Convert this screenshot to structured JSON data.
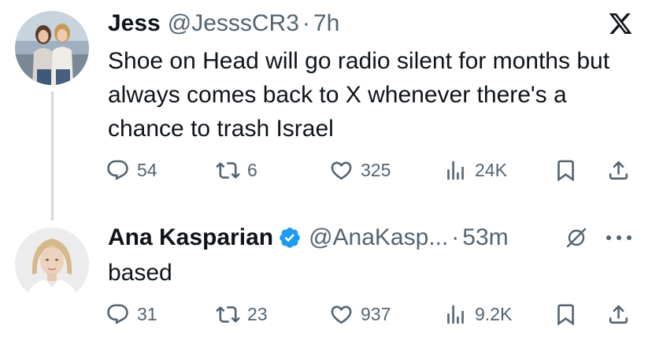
{
  "tweets": [
    {
      "author": {
        "name": "Jess",
        "handle": "@JesssCR3",
        "verified": false
      },
      "separator": "·",
      "time": "7h",
      "text": "Shoe on Head will go radio silent for months but always comes back to X whenever there's a chance to trash Israel",
      "stats": {
        "replies": "54",
        "reposts": "6",
        "likes": "325",
        "views": "24K"
      },
      "corner_icon": "x-logo-icon"
    },
    {
      "author": {
        "name": "Ana Kasparian",
        "handle": "@AnaKasp...",
        "verified": true
      },
      "separator": "·",
      "time": "53m",
      "text": "based",
      "stats": {
        "replies": "31",
        "reposts": "23",
        "likes": "937",
        "views": "9.2K"
      },
      "corner_icon": "more-options-icon"
    }
  ],
  "colors": {
    "text_primary": "#0f1419",
    "text_secondary": "#536471",
    "verified_blue": "#1d9bf0",
    "thread_line": "#cfd9de"
  }
}
